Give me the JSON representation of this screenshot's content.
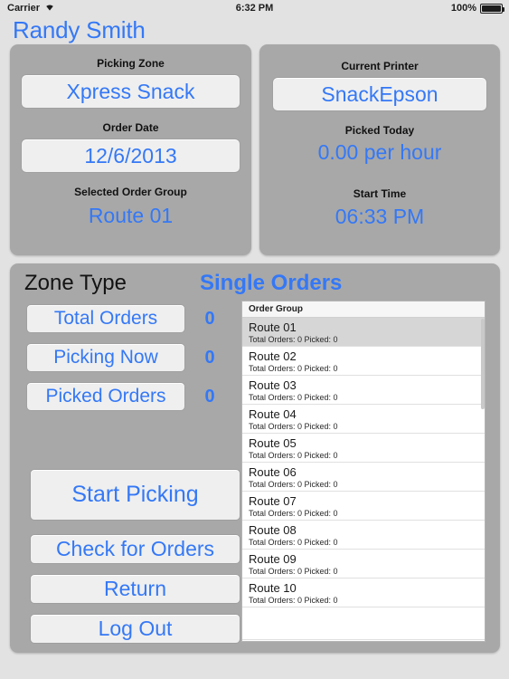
{
  "statusbar": {
    "carrier": "Carrier",
    "wifi_icon": "wifi-icon",
    "time": "6:32 PM",
    "battery_percent": "100%",
    "battery_icon": "battery-full-icon"
  },
  "header": {
    "title": "Randy Smith"
  },
  "panel_left": {
    "picking_zone_label": "Picking Zone",
    "picking_zone_value": "Xpress Snack",
    "order_date_label": "Order Date",
    "order_date_value": "12/6/2013",
    "selected_order_group_label": "Selected Order Group",
    "selected_order_group_value": "Route 01"
  },
  "panel_right": {
    "current_printer_label": "Current Printer",
    "current_printer_value": "SnackEpson",
    "picked_today_label": "Picked Today",
    "picked_today_value": "0.00 per hour",
    "start_time_label": "Start Time",
    "start_time_value": "06:33 PM"
  },
  "main": {
    "zone_type_label": "Zone Type",
    "zone_type_value": "Single Orders",
    "stats": [
      {
        "label": "Total Orders",
        "count": "0"
      },
      {
        "label": "Picking Now",
        "count": "0"
      },
      {
        "label": "Picked Orders",
        "count": "0"
      }
    ],
    "actions": {
      "start_picking": "Start Picking",
      "check_for_orders": "Check for Orders",
      "return": "Return",
      "log_out": "Log Out"
    },
    "table": {
      "header": "Order Group",
      "rows": [
        {
          "name": "Route 01",
          "detail": "Total Orders: 0 Picked: 0",
          "selected": true
        },
        {
          "name": "Route 02",
          "detail": "Total Orders: 0 Picked: 0",
          "selected": false
        },
        {
          "name": "Route 03",
          "detail": "Total Orders: 0 Picked: 0",
          "selected": false
        },
        {
          "name": "Route 04",
          "detail": "Total Orders: 0 Picked: 0",
          "selected": false
        },
        {
          "name": "Route 05",
          "detail": "Total Orders: 0 Picked: 0",
          "selected": false
        },
        {
          "name": "Route 06",
          "detail": "Total Orders: 0 Picked: 0",
          "selected": false
        },
        {
          "name": "Route 07",
          "detail": "Total Orders: 0 Picked: 0",
          "selected": false
        },
        {
          "name": "Route 08",
          "detail": "Total Orders: 0 Picked: 0",
          "selected": false
        },
        {
          "name": "Route 09",
          "detail": "Total Orders: 0 Picked: 0",
          "selected": false
        },
        {
          "name": "Route 10",
          "detail": "Total Orders: 0 Picked: 0",
          "selected": false
        }
      ]
    }
  },
  "colors": {
    "accent_blue": "#3478f6",
    "panel_gray": "#a8a8a8",
    "background": "#e2e2e2",
    "selected_row": "#d6d6d6"
  }
}
